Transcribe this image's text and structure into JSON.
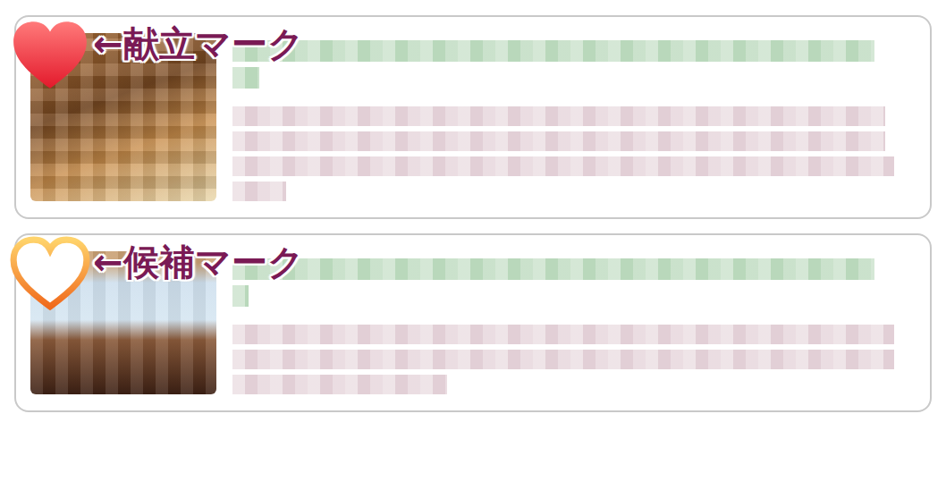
{
  "cards": [
    {
      "mark": {
        "kind": "filled",
        "label": "←献立マーク"
      }
    },
    {
      "mark": {
        "kind": "outline",
        "label": "←候補マーク"
      }
    }
  ]
}
